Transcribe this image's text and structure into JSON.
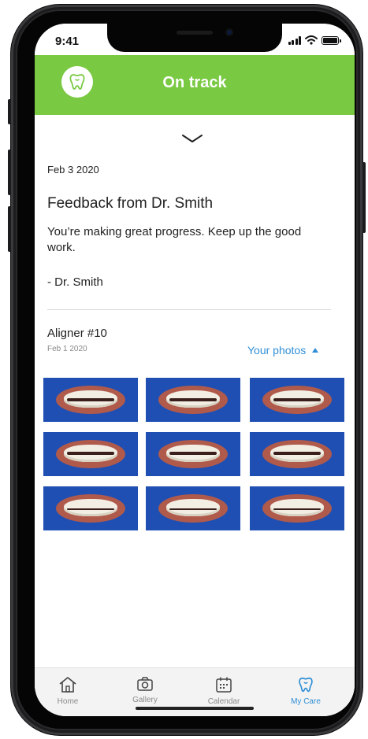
{
  "status_bar": {
    "time": "9:41"
  },
  "header": {
    "title": "On track",
    "logo_icon": "tooth-icon",
    "background": "#7ac943"
  },
  "feedback": {
    "date": "Feb 3 2020",
    "title": "Feedback from Dr. Smith",
    "body": "You’re making great progress. Keep up the good work.",
    "signature": "- Dr. Smith"
  },
  "aligner": {
    "title": "Aligner #10",
    "date": "Feb 1 2020",
    "photos_link": "Your photos",
    "photo_count": 9
  },
  "bottom_nav": {
    "active_color": "#2f8fd6",
    "items": [
      {
        "label": "Home",
        "icon": "home-icon"
      },
      {
        "label": "Gallery",
        "icon": "camera-icon"
      },
      {
        "label": "Calendar",
        "icon": "calendar-icon"
      },
      {
        "label": "My Care",
        "icon": "tooth-icon",
        "active": true
      }
    ]
  }
}
